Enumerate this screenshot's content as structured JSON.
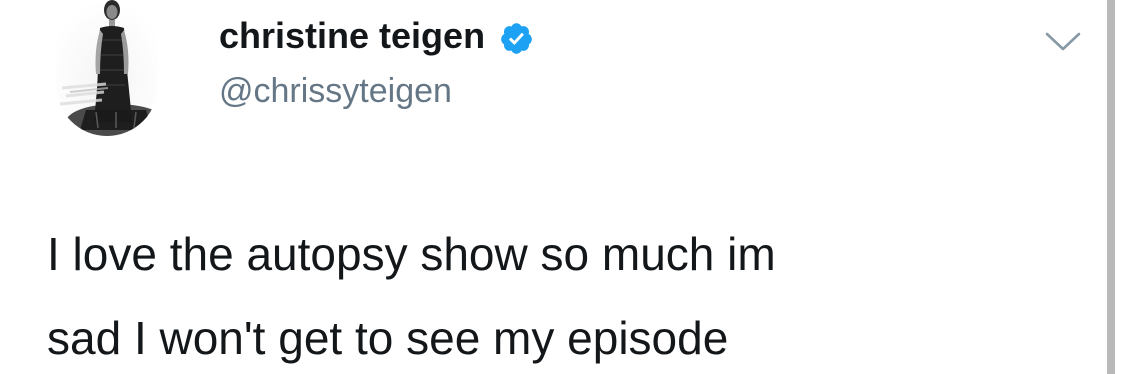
{
  "author": {
    "display_name": "christine teigen",
    "handle": "@chrissyteigen",
    "verified": true
  },
  "tweet": {
    "line1": "I love the autopsy show so much im",
    "line2": "sad I won't get to see my episode"
  },
  "icons": {
    "verified": "verified-badge-icon",
    "menu": "chevron-down-icon",
    "avatar": "profile-photo"
  },
  "colors": {
    "text": "#14171a",
    "secondary_text": "#657786",
    "verified_blue": "#1da1f2",
    "caret": "#8899a6"
  }
}
